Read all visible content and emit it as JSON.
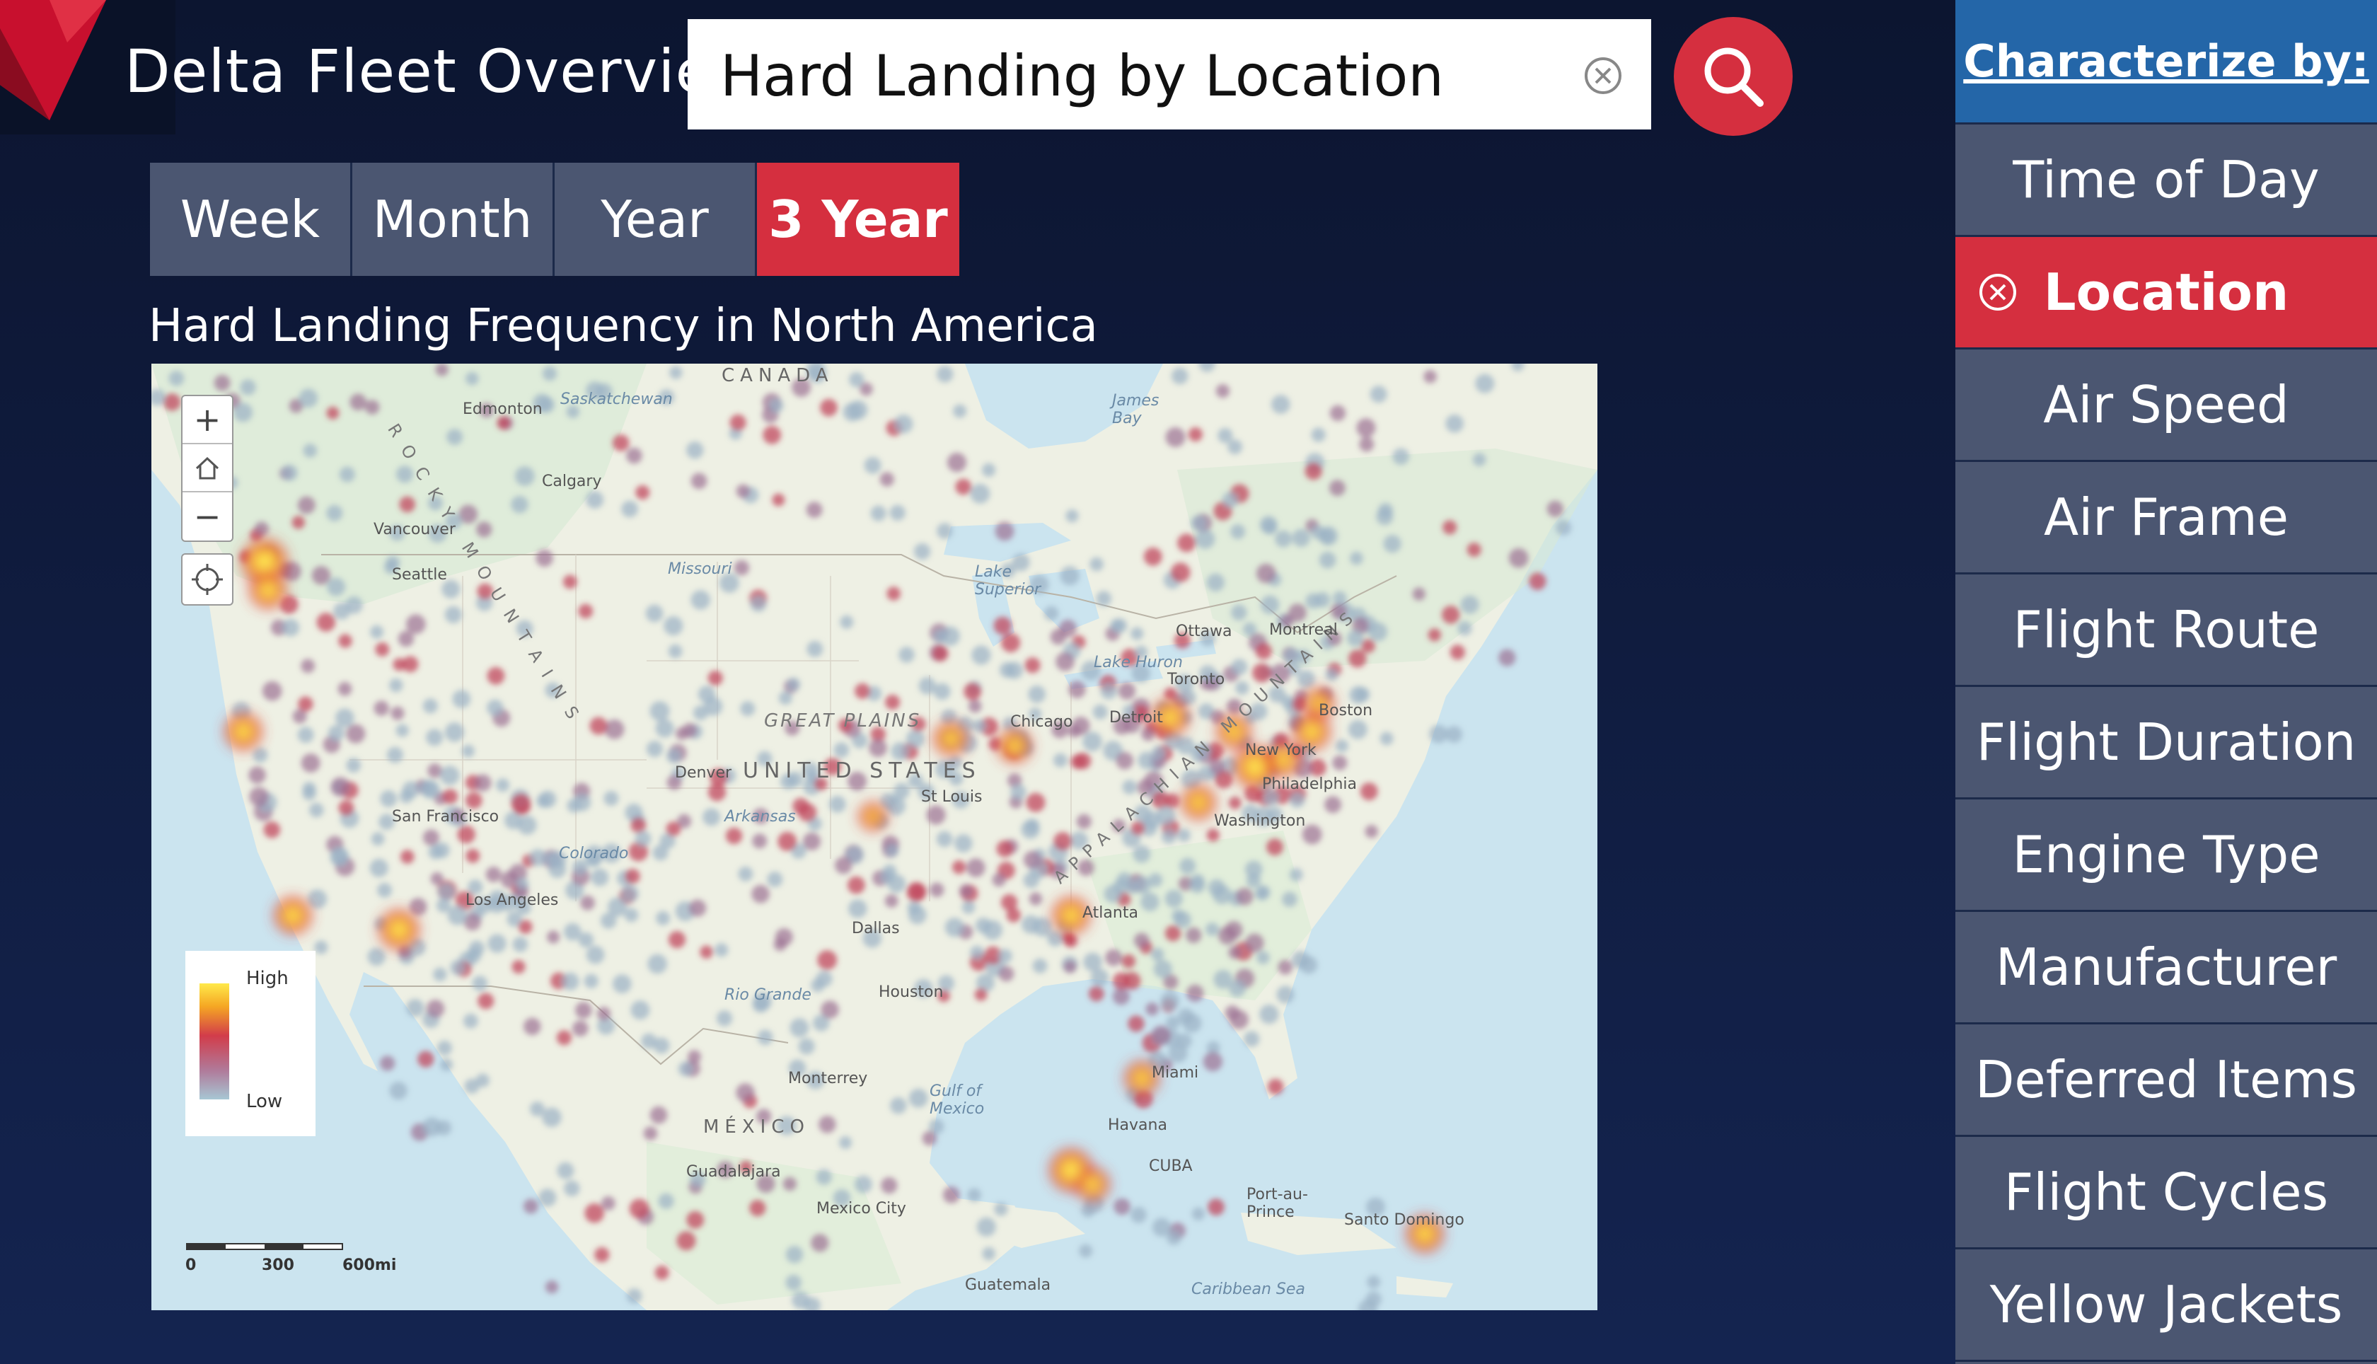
{
  "app": {
    "title": "Delta Fleet Overview"
  },
  "search": {
    "value": "Hard Landing by Location"
  },
  "time_tabs": [
    {
      "label": "Week",
      "active": false
    },
    {
      "label": "Month",
      "active": false
    },
    {
      "label": "Year",
      "active": false
    },
    {
      "label": "3 Year",
      "active": true
    }
  ],
  "map": {
    "heading": "Hard Landing Frequency in North America",
    "legend": {
      "high": "High",
      "low": "Low"
    },
    "scale": {
      "labels": [
        "0",
        "300",
        "600mi"
      ]
    },
    "labels": {
      "canada": "CANADA",
      "united_states": "UNITED STATES",
      "mexico": "MÉXICO",
      "great_plains": "GREAT PLAINS",
      "rocky_mountains": "ROCKY MOUNTAINS",
      "appalachian": "APPALACHIAN MOUNTAINS",
      "cuba": "CUBA",
      "james_bay": "James Bay",
      "lake_superior": "Lake Superior",
      "gulf_of_mexico": "Gulf of Mexico",
      "caribbean_sea": "Caribbean Sea",
      "missouri": "Missouri",
      "arkansas": "Arkansas",
      "rio_grande": "Rio Grande",
      "colorado": "Colorado",
      "saskatchewan": "Saskatchewan",
      "lake_huron": "Lake Huron"
    },
    "cities": [
      "Edmonton",
      "Calgary",
      "Vancouver",
      "Seattle",
      "San Francisco",
      "Los Angeles",
      "Denver",
      "Dallas",
      "Houston",
      "St Louis",
      "Chicago",
      "Detroit",
      "Toronto",
      "Ottawa",
      "Montreal",
      "Boston",
      "New York",
      "Philadelphia",
      "Washington",
      "Atlanta",
      "Miami",
      "Havana",
      "Monterrey",
      "Guadalajara",
      "Mexico City",
      "Guatemala",
      "Port-au-Prince",
      "Santo Domingo"
    ]
  },
  "sidebar": {
    "header": "Characterize by:",
    "items": [
      {
        "label": "Time of Day",
        "active": false
      },
      {
        "label": "Location",
        "active": true
      },
      {
        "label": "Air Speed",
        "active": false
      },
      {
        "label": "Air Frame",
        "active": false
      },
      {
        "label": "Flight Route",
        "active": false
      },
      {
        "label": "Flight Duration",
        "active": false
      },
      {
        "label": "Engine Type",
        "active": false
      },
      {
        "label": "Manufacturer",
        "active": false
      },
      {
        "label": "Deferred Items",
        "active": false
      },
      {
        "label": "Flight Cycles",
        "active": false
      },
      {
        "label": "Yellow Jackets",
        "active": false
      }
    ]
  },
  "colors": {
    "accent": "#d52f3f",
    "header_blue": "#2466a8",
    "panel": "#4b5671"
  },
  "icons": {
    "logo": "delta-widget-icon",
    "search": "search-icon",
    "clear": "clear-circle-x-icon"
  }
}
